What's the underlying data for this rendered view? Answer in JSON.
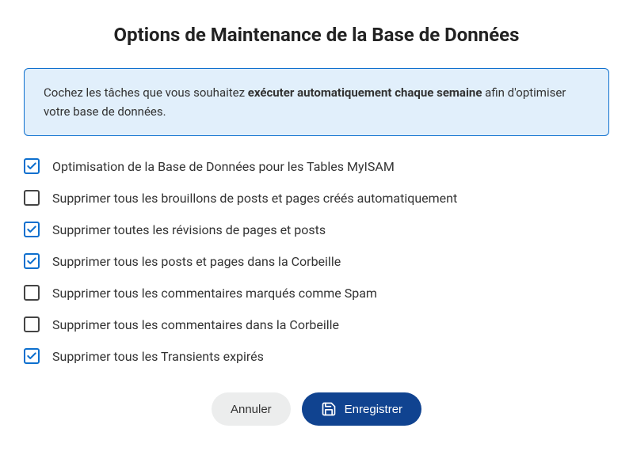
{
  "title": "Options de Maintenance de la Base de Données",
  "info": {
    "pre": "Cochez les tâches que vous souhaitez ",
    "bold": "exécuter automatiquement chaque semaine",
    "post": " afin d'optimiser votre base de données."
  },
  "options": [
    {
      "checked": true,
      "label": "Optimisation de la Base de Données pour les Tables MyISAM"
    },
    {
      "checked": false,
      "label": "Supprimer tous les brouillons de posts et pages créés automatiquement"
    },
    {
      "checked": true,
      "label": "Supprimer toutes les révisions de pages et posts"
    },
    {
      "checked": true,
      "label": "Supprimer tous les posts et pages dans la Corbeille"
    },
    {
      "checked": false,
      "label": "Supprimer tous les commentaires marqués comme Spam"
    },
    {
      "checked": false,
      "label": "Supprimer tous les commentaires dans la Corbeille"
    },
    {
      "checked": true,
      "label": "Supprimer tous les Transients expirés"
    }
  ],
  "buttons": {
    "cancel": "Annuler",
    "save": "Enregistrer"
  }
}
